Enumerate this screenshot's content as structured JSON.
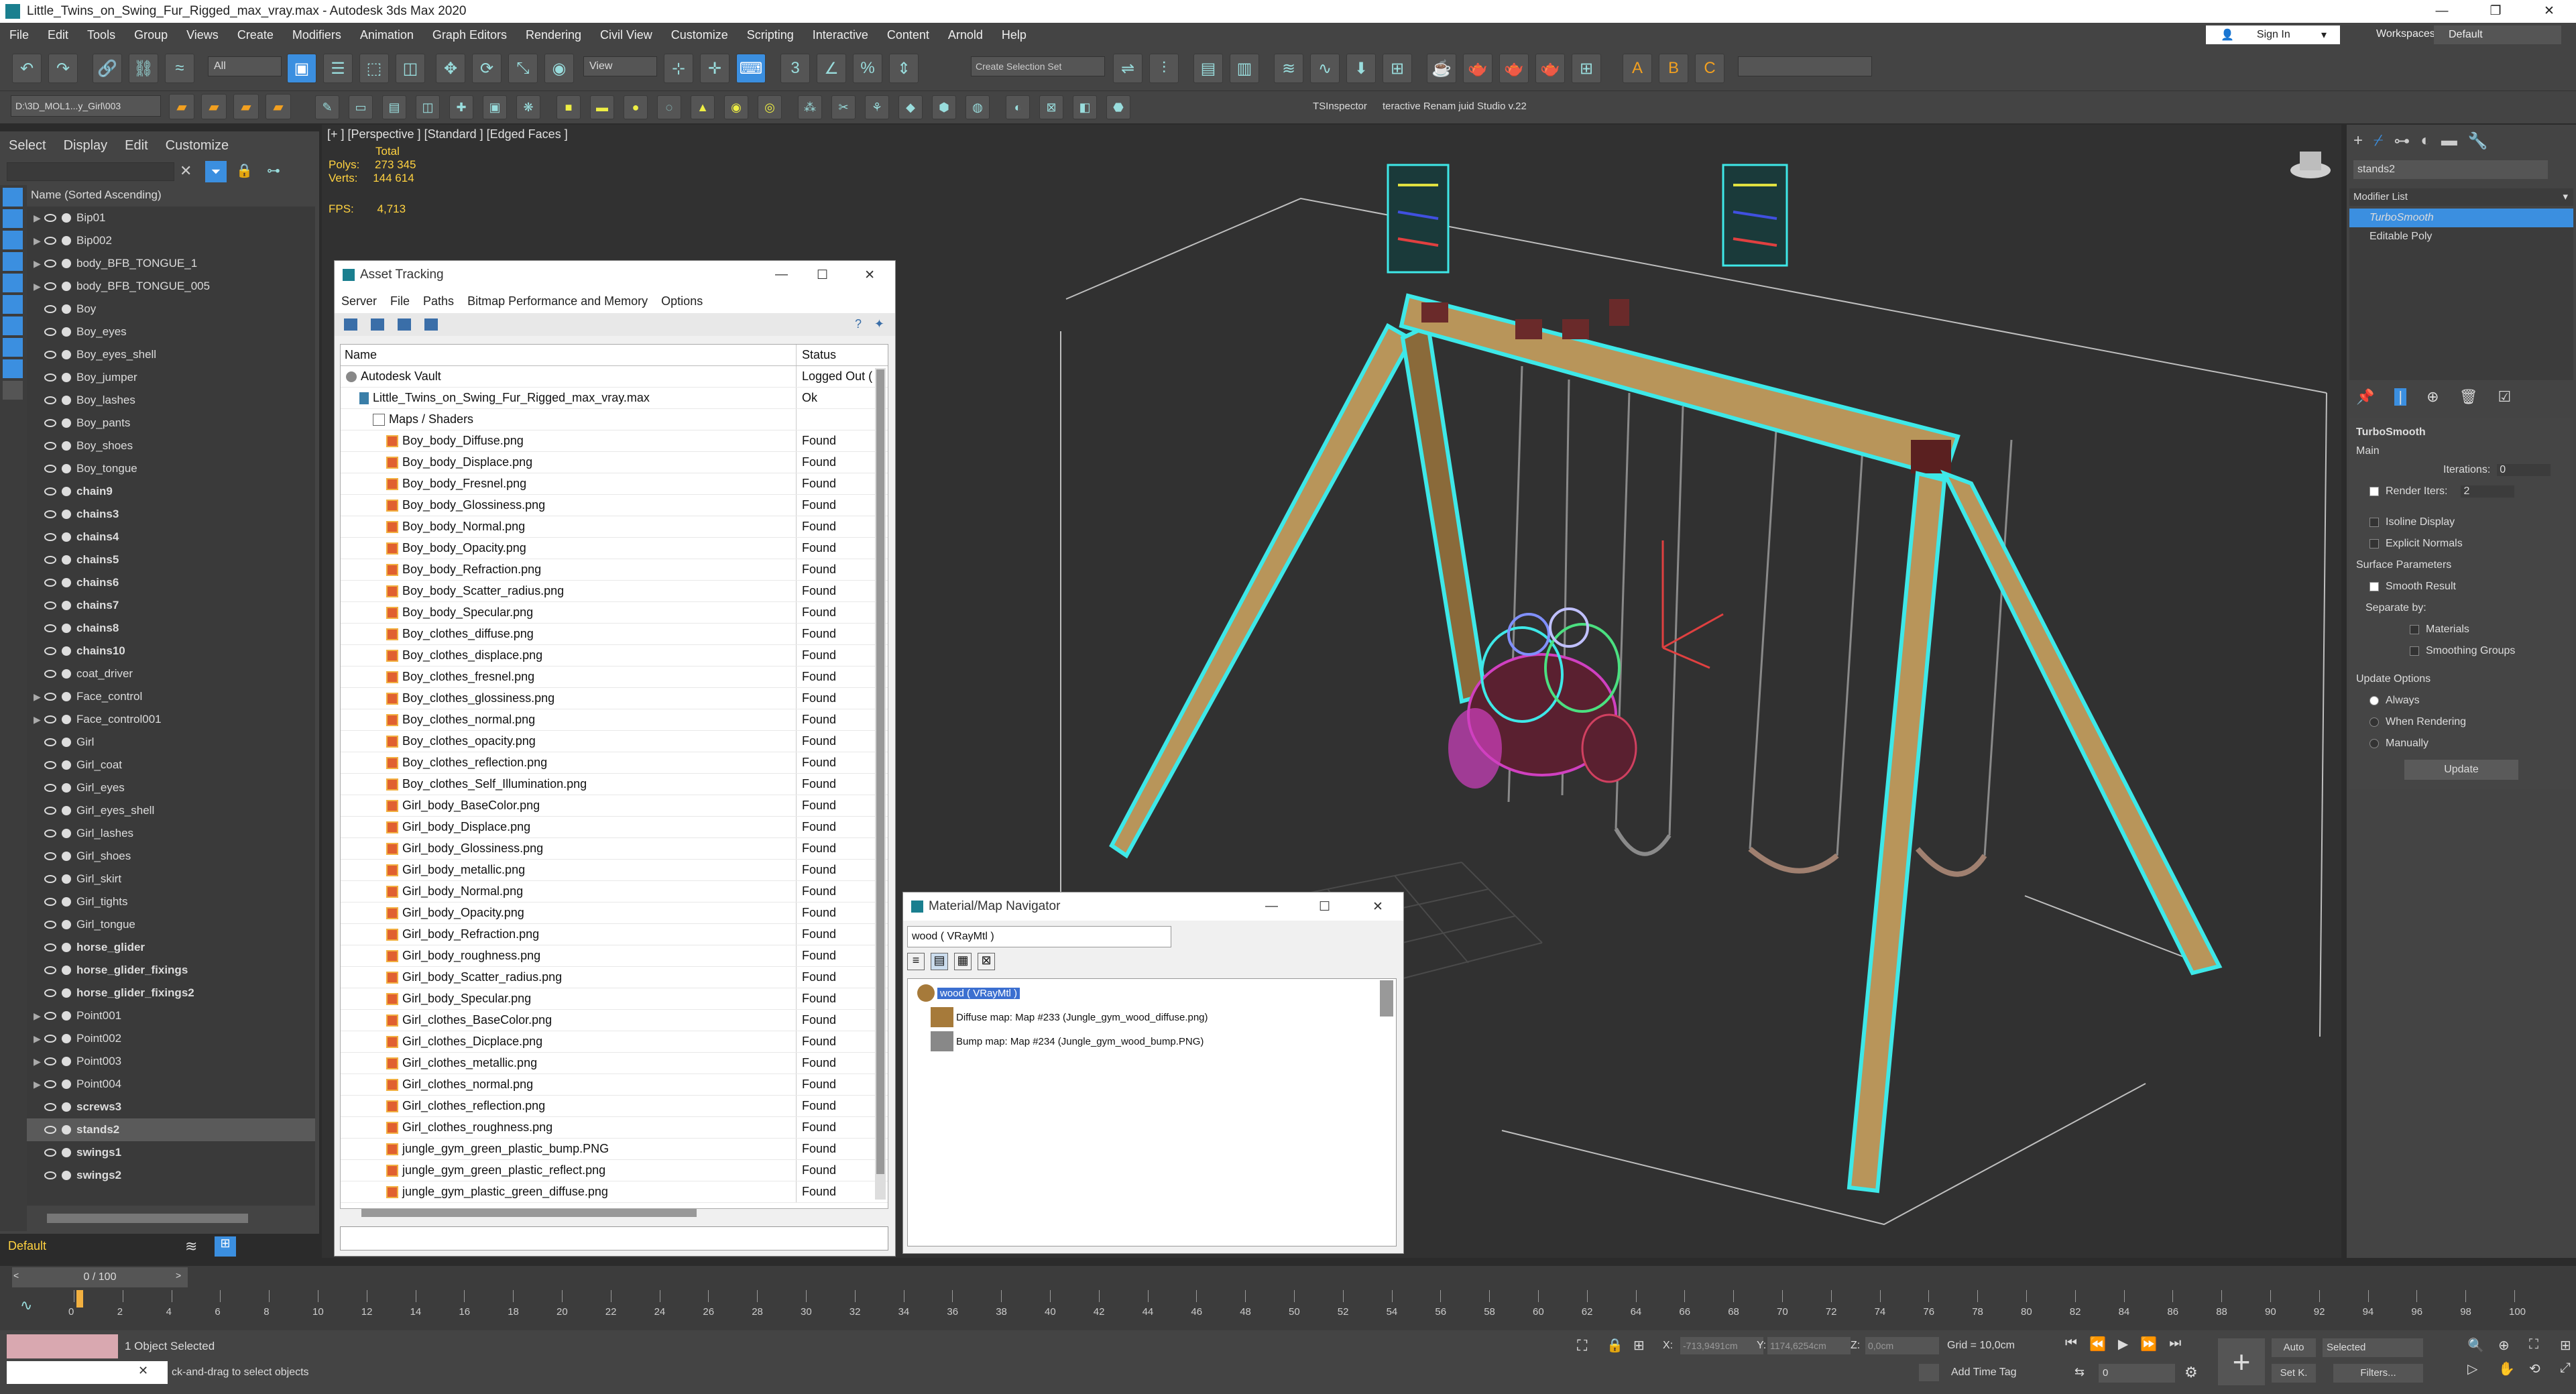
{
  "app": {
    "title": "Little_Twins_on_Swing_Fur_Rigged_max_vray.max - Autodesk 3ds Max 2020",
    "sign_in": "Sign In",
    "workspaces_label": "Workspaces:",
    "workspaces_value": "Default"
  },
  "menu": [
    "File",
    "Edit",
    "Tools",
    "Group",
    "Views",
    "Create",
    "Modifiers",
    "Animation",
    "Graph Editors",
    "Rendering",
    "Civil View",
    "Customize",
    "Scripting",
    "Interactive",
    "Content",
    "Arnold",
    "Help"
  ],
  "toolbar": {
    "filter_value": "All",
    "view_value": "View",
    "selection_set_placeholder": "Create Selection Set",
    "path_value": "D:\\3D_MOL1...y_Girl\\003",
    "ts_inspector": "TSInspector",
    "rename_tool": "teractive Renam juid Studio v.22"
  },
  "scene_explorer": {
    "tabs": [
      "Select",
      "Display",
      "Edit",
      "Customize"
    ],
    "header": "Name (Sorted Ascending)",
    "items": [
      {
        "name": "Bip01",
        "bold": false,
        "expand": true
      },
      {
        "name": "Bip002",
        "bold": false,
        "expand": true
      },
      {
        "name": "body_BFB_TONGUE_1",
        "bold": false,
        "expand": true
      },
      {
        "name": "body_BFB_TONGUE_005",
        "bold": false,
        "expand": true
      },
      {
        "name": "Boy",
        "bold": false,
        "expand": false
      },
      {
        "name": "Boy_eyes",
        "bold": false,
        "expand": false
      },
      {
        "name": "Boy_eyes_shell",
        "bold": false,
        "expand": false
      },
      {
        "name": "Boy_jumper",
        "bold": false,
        "expand": false
      },
      {
        "name": "Boy_lashes",
        "bold": false,
        "expand": false
      },
      {
        "name": "Boy_pants",
        "bold": false,
        "expand": false
      },
      {
        "name": "Boy_shoes",
        "bold": false,
        "expand": false
      },
      {
        "name": "Boy_tongue",
        "bold": false,
        "expand": false
      },
      {
        "name": "chain9",
        "bold": true,
        "expand": false
      },
      {
        "name": "chains3",
        "bold": true,
        "expand": false
      },
      {
        "name": "chains4",
        "bold": true,
        "expand": false
      },
      {
        "name": "chains5",
        "bold": true,
        "expand": false
      },
      {
        "name": "chains6",
        "bold": true,
        "expand": false
      },
      {
        "name": "chains7",
        "bold": true,
        "expand": false
      },
      {
        "name": "chains8",
        "bold": true,
        "expand": false
      },
      {
        "name": "chains10",
        "bold": true,
        "expand": false
      },
      {
        "name": "coat_driver",
        "bold": false,
        "expand": false
      },
      {
        "name": "Face_control",
        "bold": false,
        "expand": true
      },
      {
        "name": "Face_control001",
        "bold": false,
        "expand": true
      },
      {
        "name": "Girl",
        "bold": false,
        "expand": false
      },
      {
        "name": "Girl_coat",
        "bold": false,
        "expand": false
      },
      {
        "name": "Girl_eyes",
        "bold": false,
        "expand": false
      },
      {
        "name": "Girl_eyes_shell",
        "bold": false,
        "expand": false
      },
      {
        "name": "Girl_lashes",
        "bold": false,
        "expand": false
      },
      {
        "name": "Girl_shoes",
        "bold": false,
        "expand": false
      },
      {
        "name": "Girl_skirt",
        "bold": false,
        "expand": false
      },
      {
        "name": "Girl_tights",
        "bold": false,
        "expand": false
      },
      {
        "name": "Girl_tongue",
        "bold": false,
        "expand": false
      },
      {
        "name": "horse_glider",
        "bold": true,
        "expand": false
      },
      {
        "name": "horse_glider_fixings",
        "bold": true,
        "expand": false
      },
      {
        "name": "horse_glider_fixings2",
        "bold": true,
        "expand": false
      },
      {
        "name": "Point001",
        "bold": false,
        "expand": true
      },
      {
        "name": "Point002",
        "bold": false,
        "expand": true
      },
      {
        "name": "Point003",
        "bold": false,
        "expand": true
      },
      {
        "name": "Point004",
        "bold": false,
        "expand": true
      },
      {
        "name": "screws3",
        "bold": true,
        "expand": false
      },
      {
        "name": "stands2",
        "bold": true,
        "expand": false,
        "selected": true
      },
      {
        "name": "swings1",
        "bold": true,
        "expand": false
      },
      {
        "name": "swings2",
        "bold": true,
        "expand": false
      }
    ],
    "layer": "Default"
  },
  "viewport": {
    "label": "[+ ] [Perspective ]  [Standard ]  [Edged Faces ]",
    "total": "Total",
    "polys_label": "Polys:",
    "polys_value": "273 345",
    "verts_label": "Verts:",
    "verts_value": "144 614",
    "fps_label": "FPS:",
    "fps_value": "4,713"
  },
  "asset_tracking": {
    "title": "Asset Tracking",
    "menu": [
      "Server",
      "File",
      "Paths",
      "Bitmap Performance and Memory",
      "Options"
    ],
    "col_name": "Name",
    "col_status": "Status",
    "rows": [
      {
        "name": "Autodesk Vault",
        "status": "Logged Out (",
        "indent": 0,
        "type": "vault"
      },
      {
        "name": "Little_Twins_on_Swing_Fur_Rigged_max_vray.max",
        "status": "Ok",
        "indent": 1,
        "type": "max"
      },
      {
        "name": "Maps / Shaders",
        "status": "",
        "indent": 2,
        "type": "folder"
      },
      {
        "name": "Boy_body_Diffuse.png",
        "status": "Found",
        "indent": 3,
        "type": "file"
      },
      {
        "name": "Boy_body_Displace.png",
        "status": "Found",
        "indent": 3,
        "type": "file"
      },
      {
        "name": "Boy_body_Fresnel.png",
        "status": "Found",
        "indent": 3,
        "type": "file"
      },
      {
        "name": "Boy_body_Glossiness.png",
        "status": "Found",
        "indent": 3,
        "type": "file"
      },
      {
        "name": "Boy_body_Normal.png",
        "status": "Found",
        "indent": 3,
        "type": "file"
      },
      {
        "name": "Boy_body_Opacity.png",
        "status": "Found",
        "indent": 3,
        "type": "file"
      },
      {
        "name": "Boy_body_Refraction.png",
        "status": "Found",
        "indent": 3,
        "type": "file"
      },
      {
        "name": "Boy_body_Scatter_radius.png",
        "status": "Found",
        "indent": 3,
        "type": "file"
      },
      {
        "name": "Boy_body_Specular.png",
        "status": "Found",
        "indent": 3,
        "type": "file"
      },
      {
        "name": "Boy_clothes_diffuse.png",
        "status": "Found",
        "indent": 3,
        "type": "file"
      },
      {
        "name": "Boy_clothes_displace.png",
        "status": "Found",
        "indent": 3,
        "type": "file"
      },
      {
        "name": "Boy_clothes_fresnel.png",
        "status": "Found",
        "indent": 3,
        "type": "file"
      },
      {
        "name": "Boy_clothes_glossiness.png",
        "status": "Found",
        "indent": 3,
        "type": "file"
      },
      {
        "name": "Boy_clothes_normal.png",
        "status": "Found",
        "indent": 3,
        "type": "file"
      },
      {
        "name": "Boy_clothes_opacity.png",
        "status": "Found",
        "indent": 3,
        "type": "file"
      },
      {
        "name": "Boy_clothes_reflection.png",
        "status": "Found",
        "indent": 3,
        "type": "file"
      },
      {
        "name": "Boy_clothes_Self_Illumination.png",
        "status": "Found",
        "indent": 3,
        "type": "file"
      },
      {
        "name": "Girl_body_BaseColor.png",
        "status": "Found",
        "indent": 3,
        "type": "file"
      },
      {
        "name": "Girl_body_Displace.png",
        "status": "Found",
        "indent": 3,
        "type": "file"
      },
      {
        "name": "Girl_body_Glossiness.png",
        "status": "Found",
        "indent": 3,
        "type": "file"
      },
      {
        "name": "Girl_body_metallic.png",
        "status": "Found",
        "indent": 3,
        "type": "file"
      },
      {
        "name": "Girl_body_Normal.png",
        "status": "Found",
        "indent": 3,
        "type": "file"
      },
      {
        "name": "Girl_body_Opacity.png",
        "status": "Found",
        "indent": 3,
        "type": "file"
      },
      {
        "name": "Girl_body_Refraction.png",
        "status": "Found",
        "indent": 3,
        "type": "file"
      },
      {
        "name": "Girl_body_roughness.png",
        "status": "Found",
        "indent": 3,
        "type": "file"
      },
      {
        "name": "Girl_body_Scatter_radius.png",
        "status": "Found",
        "indent": 3,
        "type": "file"
      },
      {
        "name": "Girl_body_Specular.png",
        "status": "Found",
        "indent": 3,
        "type": "file"
      },
      {
        "name": "Girl_clothes_BaseColor.png",
        "status": "Found",
        "indent": 3,
        "type": "file"
      },
      {
        "name": "Girl_clothes_Dicplace.png",
        "status": "Found",
        "indent": 3,
        "type": "file"
      },
      {
        "name": "Girl_clothes_metallic.png",
        "status": "Found",
        "indent": 3,
        "type": "file"
      },
      {
        "name": "Girl_clothes_normal.png",
        "status": "Found",
        "indent": 3,
        "type": "file"
      },
      {
        "name": "Girl_clothes_reflection.png",
        "status": "Found",
        "indent": 3,
        "type": "file"
      },
      {
        "name": "Girl_clothes_roughness.png",
        "status": "Found",
        "indent": 3,
        "type": "file"
      },
      {
        "name": "jungle_gym_green_plastic_bump.PNG",
        "status": "Found",
        "indent": 3,
        "type": "file"
      },
      {
        "name": "jungle_gym_green_plastic_reflect.png",
        "status": "Found",
        "indent": 3,
        "type": "file"
      },
      {
        "name": "jungle_gym_plastic_green_diffuse.png",
        "status": "Found",
        "indent": 3,
        "type": "file"
      }
    ]
  },
  "material_navigator": {
    "title": "Material/Map Navigator",
    "current": "wood  ( VRayMtl )",
    "tree_root": "wood  ( VRayMtl )",
    "diffuse": "Diffuse map: Map #233 (Jungle_gym_wood_diffuse.png)",
    "bump": "Bump map: Map #234 (Jungle_gym_wood_bump.PNG)"
  },
  "command_panel": {
    "object_name": "stands2",
    "modifier_list": "Modifier List",
    "stack": [
      "TurboSmooth",
      "Editable Poly"
    ],
    "turbosmooth": {
      "title": "TurboSmooth",
      "main": "Main",
      "iterations_label": "Iterations:",
      "iterations_value": "0",
      "render_iters_label": "Render Iters:",
      "render_iters_value": "2",
      "isoline": "Isoline Display",
      "explicit_normals": "Explicit Normals",
      "surface_params": "Surface Parameters",
      "smooth_result": "Smooth Result",
      "separate_by": "Separate by:",
      "materials": "Materials",
      "smoothing_groups": "Smoothing Groups",
      "update_options": "Update Options",
      "always": "Always",
      "when_rendering": "When Rendering",
      "manually": "Manually",
      "update_button": "Update"
    }
  },
  "timeline": {
    "frame_display": "0 / 100",
    "ticks": [
      "0",
      "2",
      "4",
      "6",
      "8",
      "10",
      "12",
      "14",
      "16",
      "18",
      "20",
      "22",
      "24",
      "26",
      "28",
      "30",
      "32",
      "34",
      "36",
      "38",
      "40",
      "42",
      "44",
      "46",
      "48",
      "50",
      "52",
      "54",
      "56",
      "58",
      "60",
      "62",
      "64",
      "66",
      "68",
      "70",
      "72",
      "74",
      "76",
      "78",
      "80",
      "82",
      "84",
      "86",
      "88",
      "90",
      "92",
      "94",
      "96",
      "98",
      "100"
    ]
  },
  "status_bar": {
    "objects_selected": "1 Object Selected",
    "prompt": "ck-and-drag to select objects",
    "x_label": "X:",
    "x_value": "-713,9491cm",
    "y_label": "Y:",
    "y_value": "1174,6254cm",
    "z_label": "Z:",
    "z_value": "0,0cm",
    "grid": "Grid = 10,0cm",
    "add_time_tag": "Add Time Tag",
    "auto": "Auto",
    "selected": "Selected",
    "set_k": "Set K.",
    "filters": "Filters...",
    "frame": "0"
  },
  "colors": {
    "selection_cyan": "#3ee8e8",
    "wood": "#b8955a",
    "stats_yellow": "#ffd240",
    "active_blue": "#3b8fe0"
  }
}
